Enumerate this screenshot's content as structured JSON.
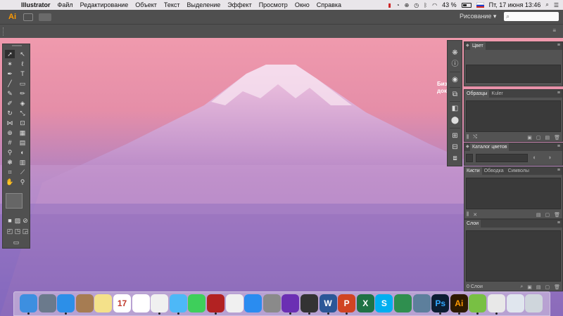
{
  "menubar": {
    "app_name": "Illustrator",
    "items": [
      "Файл",
      "Редактирование",
      "Объект",
      "Текст",
      "Выделение",
      "Эффект",
      "Просмотр",
      "Окно",
      "Справка"
    ],
    "battery": "43 %",
    "datetime": "Пт, 17 июня  13:46",
    "icons": [
      "apple-icon",
      "notification-badge-icon",
      "time-machine-icon",
      "accessibility-icon",
      "clock-icon",
      "bluetooth-icon",
      "wifi-icon",
      "battery-icon",
      "russian-flag-icon",
      "search-icon",
      "list-icon"
    ]
  },
  "appbar": {
    "logo": "Ai",
    "workspace": "Рисование",
    "search_placeholder": ""
  },
  "background_text": "Биз\nдок",
  "panels": {
    "color": {
      "tab": "Цвет"
    },
    "swatches": {
      "tabs": [
        "Образцы",
        "Kuler"
      ]
    },
    "color_catalog": {
      "tab": "Каталог цветов"
    },
    "brushes": {
      "tabs": [
        "Кисти",
        "Обводка",
        "Символы"
      ]
    },
    "layers": {
      "tab": "Слои",
      "count": "0 Слои"
    }
  },
  "dock": {
    "apps": [
      {
        "name": "finder",
        "label": "",
        "color": "#3d8fe0"
      },
      {
        "name": "launchpad",
        "label": "",
        "color": "#6b7a8c"
      },
      {
        "name": "safari",
        "label": "",
        "color": "#2c8fe8"
      },
      {
        "name": "contacts",
        "label": "",
        "color": "#a67c52"
      },
      {
        "name": "notes",
        "label": "",
        "color": "#f4e18a"
      },
      {
        "name": "calendar",
        "label": "17",
        "color": "#ffffff"
      },
      {
        "name": "photos-app",
        "label": "",
        "color": "#ffffff"
      },
      {
        "name": "photos",
        "label": "",
        "color": "#f0f0f0"
      },
      {
        "name": "messages",
        "label": "",
        "color": "#4db8f7"
      },
      {
        "name": "facetime",
        "label": "",
        "color": "#3ecf5b"
      },
      {
        "name": "photo-booth",
        "label": "",
        "color": "#b22222"
      },
      {
        "name": "itunes",
        "label": "",
        "color": "#f0f0f0"
      },
      {
        "name": "app-store",
        "label": "",
        "color": "#2a8cf0"
      },
      {
        "name": "system-preferences",
        "label": "",
        "color": "#8a8a8a"
      },
      {
        "name": "imovie",
        "label": "",
        "color": "#6b2fb3"
      },
      {
        "name": "final-cut",
        "label": "",
        "color": "#333333"
      },
      {
        "name": "word",
        "label": "W",
        "color": "#2b5797"
      },
      {
        "name": "powerpoint",
        "label": "P",
        "color": "#d04423"
      },
      {
        "name": "excel",
        "label": "X",
        "color": "#1f7244"
      },
      {
        "name": "skype",
        "label": "S",
        "color": "#00aff0"
      },
      {
        "name": "world-app",
        "label": "",
        "color": "#2f8f4f"
      },
      {
        "name": "utility",
        "label": "",
        "color": "#5d7f9c"
      },
      {
        "name": "photoshop",
        "label": "Ps",
        "color": "#0c1e33"
      },
      {
        "name": "illustrator",
        "label": "Ai",
        "color": "#2d1a00"
      },
      {
        "name": "utorrent",
        "label": "",
        "color": "#78c043"
      },
      {
        "name": "preview",
        "label": "",
        "color": "#e8e8e8"
      },
      {
        "name": "mail-doc",
        "label": "",
        "color": "#e0e6ee"
      },
      {
        "name": "trash",
        "label": "",
        "color": "#cfd6dc"
      }
    ]
  }
}
